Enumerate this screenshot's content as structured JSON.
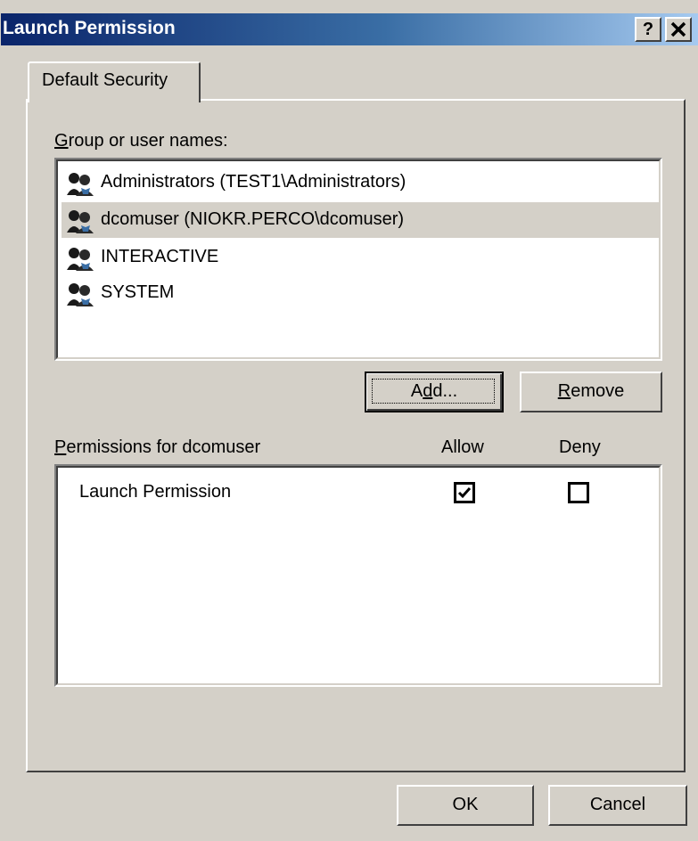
{
  "window": {
    "title": "Launch Permission",
    "help_button": "?",
    "close_button": "✕"
  },
  "tabs": [
    {
      "label": "Default Security",
      "selected": true
    }
  ],
  "users_section": {
    "label_hotkey": "G",
    "label_rest": "roup or user names:",
    "items": [
      {
        "name": "Administrators (TEST1\\Administrators)",
        "icon": "user-group-icon",
        "selected": false
      },
      {
        "name": "dcomuser (NIOKR.PERCO\\dcomuser)",
        "icon": "user-group-icon",
        "selected": true
      },
      {
        "name": "INTERACTIVE",
        "icon": "user-group-icon",
        "selected": false
      },
      {
        "name": "SYSTEM",
        "icon": "user-group-icon",
        "selected": false
      }
    ]
  },
  "buttons": {
    "add_pre": "A",
    "add_hotkey": "d",
    "add_post": "d...",
    "remove_hotkey": "R",
    "remove_rest": "emove",
    "ok": "OK",
    "cancel": "Cancel"
  },
  "permissions_section": {
    "label_hotkey": "P",
    "label_rest": "ermissions for dcomuser",
    "allow_header": "Allow",
    "deny_header": "Deny",
    "rows": [
      {
        "name": "Launch Permission",
        "allow": true,
        "deny": false
      }
    ]
  },
  "colors": {
    "title_gradient_start": "#0a246a",
    "title_gradient_end": "#a6caf0",
    "face": "#d4d0c8",
    "selected_row": "#d4d0c8"
  }
}
